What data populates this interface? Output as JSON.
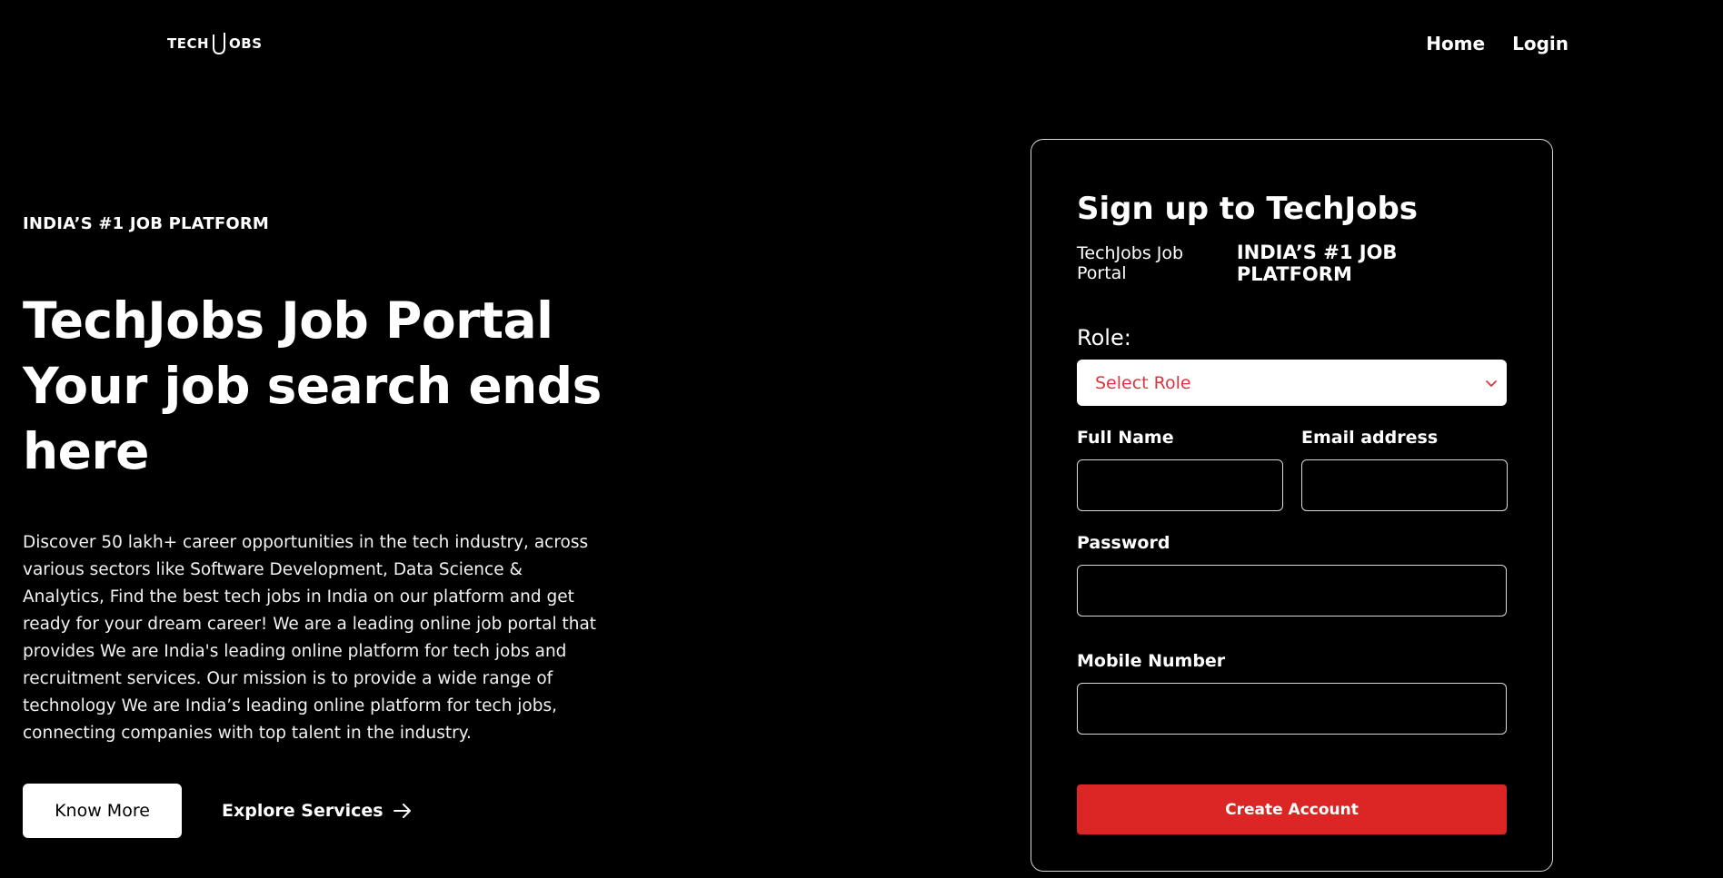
{
  "brand": {
    "logo_text_left": "TECH",
    "logo_text_right": "OBS"
  },
  "nav": {
    "home": "Home",
    "login": "Login"
  },
  "hero": {
    "eyebrow": "INDIA’S #1 JOB PLATFORM",
    "headline_line1": "TechJobs Job Portal",
    "headline_line2": "Your job search ends",
    "headline_line3": "here",
    "description": "Discover 50 lakh+ career opportunities in the tech industry, across various sectors like Software Development, Data Science & Analytics, Find the best tech jobs in India on our platform and get ready for your dream career! We are a leading online job portal that provides We are India's leading online platform for tech jobs and recruitment services. Our mission is to provide a wide range of technology We are India’s leading online platform for tech jobs, connecting companies with top talent in the industry.",
    "know_more": "Know More",
    "explore": "Explore Services"
  },
  "signup": {
    "title": "Sign up to TechJobs",
    "sub_plain": "TechJobs Job Portal",
    "sub_strong": "INDIA’S #1 JOB PLATFORM",
    "role_label": "Role:",
    "role_selected": "Select Role",
    "full_name_label": "Full Name",
    "email_label": "Email address",
    "password_label": "Password",
    "mobile_label": "Mobile Number",
    "full_name_value": "",
    "email_value": "",
    "password_value": "",
    "mobile_value": "",
    "create_button": "Create Account"
  },
  "colors": {
    "accent": "#dc2626",
    "placeholder_red": "#d9363e",
    "background": "#000000"
  }
}
